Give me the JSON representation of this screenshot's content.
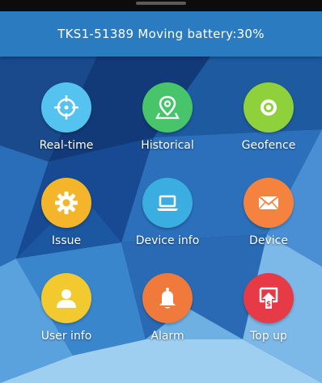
{
  "status_bar": {
    "text": "TKS1-51389 Moving battery:30%"
  },
  "colors": {
    "header": "#2a7bbf",
    "realtime": "#55c3f0",
    "historical": "#48c56a",
    "geofence": "#8fd13a",
    "issue": "#f4b52a",
    "device_info": "#3aaee0",
    "device": "#f5833f",
    "user_info": "#f2c92e",
    "alarm": "#f07a3c",
    "topup": "#e63a46"
  },
  "menu": {
    "realtime": {
      "label": "Real-time",
      "icon": "crosshair-icon"
    },
    "historical": {
      "label": "Historical",
      "icon": "map-pin-icon"
    },
    "geofence": {
      "label": "Geofence",
      "icon": "target-circle-icon"
    },
    "issue": {
      "label": "Issue",
      "icon": "gear-icon"
    },
    "device_info": {
      "label": "Device info",
      "icon": "laptop-icon"
    },
    "device": {
      "label": "Device",
      "icon": "envelope-icon"
    },
    "user_info": {
      "label": "User info",
      "icon": "user-icon"
    },
    "alarm": {
      "label": "Alarm",
      "icon": "bell-icon"
    },
    "topup": {
      "label": "Top up",
      "icon": "top-up-icon"
    }
  }
}
